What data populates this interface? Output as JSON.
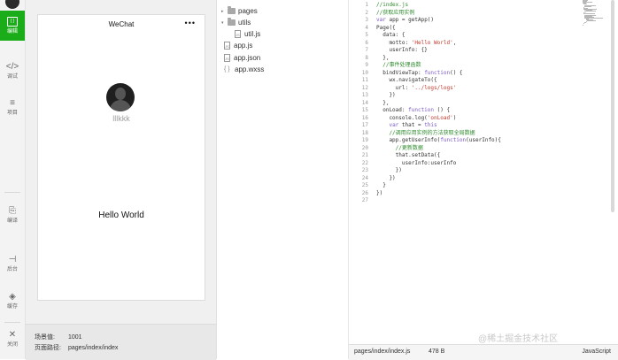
{
  "sidebar": {
    "items": [
      {
        "label": "编辑",
        "icon": "code-box-icon",
        "glyph": "{ }"
      },
      {
        "label": "调试",
        "icon": "angle-brackets-icon",
        "glyph": "</>"
      },
      {
        "label": "项目",
        "icon": "list-icon",
        "glyph": "≡"
      },
      {
        "label": "编译",
        "icon": "compile-icon",
        "glyph": "⎘"
      },
      {
        "label": "后台",
        "icon": "backend-icon",
        "glyph": "⊣"
      },
      {
        "label": "缓存",
        "icon": "layers-icon",
        "glyph": "◈"
      },
      {
        "label": "关闭",
        "icon": "close-icon",
        "glyph": "✕"
      }
    ]
  },
  "simulator": {
    "nav_title": "WeChat",
    "menu_glyph": "•••",
    "nickname": "lllkkk",
    "hello": "Hello World",
    "status": {
      "scene_label": "场景值:",
      "scene_value": "1001",
      "path_label": "页面路径:",
      "path_value": "pages/index/index"
    }
  },
  "file_tree": {
    "items": [
      {
        "name": "pages",
        "kind": "folder",
        "caret": "▸"
      },
      {
        "name": "utils",
        "kind": "folder",
        "caret": "▾"
      },
      {
        "name": "util.js",
        "kind": "file",
        "badge": "JS"
      },
      {
        "name": "app.js",
        "kind": "file",
        "badge": "JS"
      },
      {
        "name": "app.json",
        "kind": "file",
        "badge": "JS"
      },
      {
        "name": "app.wxss",
        "kind": "braces",
        "badge": "{ }"
      }
    ]
  },
  "editor": {
    "lines": [
      "//index.js",
      "//获取应用实例",
      "var app = getApp()",
      "Page({",
      "  data: {",
      "    motto: 'Hello World',",
      "    userInfo: {}",
      "  },",
      "  //事件处理函数",
      "  bindViewTap: function() {",
      "    wx.navigateTo({",
      "      url: '../logs/logs'",
      "    })",
      "  },",
      "  onLoad: function () {",
      "    console.log('onLoad')",
      "    var that = this",
      "    //调用应用实例的方法获取全局数据",
      "    app.getUserInfo(function(userInfo){",
      "      //更新数据",
      "      that.setData({",
      "        userInfo:userInfo",
      "      })",
      "    })",
      "  }",
      "})",
      ""
    ],
    "status": {
      "path": "pages/index/index.js",
      "size": "478 B",
      "language": "JavaScript"
    }
  },
  "watermark": "@稀土掘金技术社区"
}
